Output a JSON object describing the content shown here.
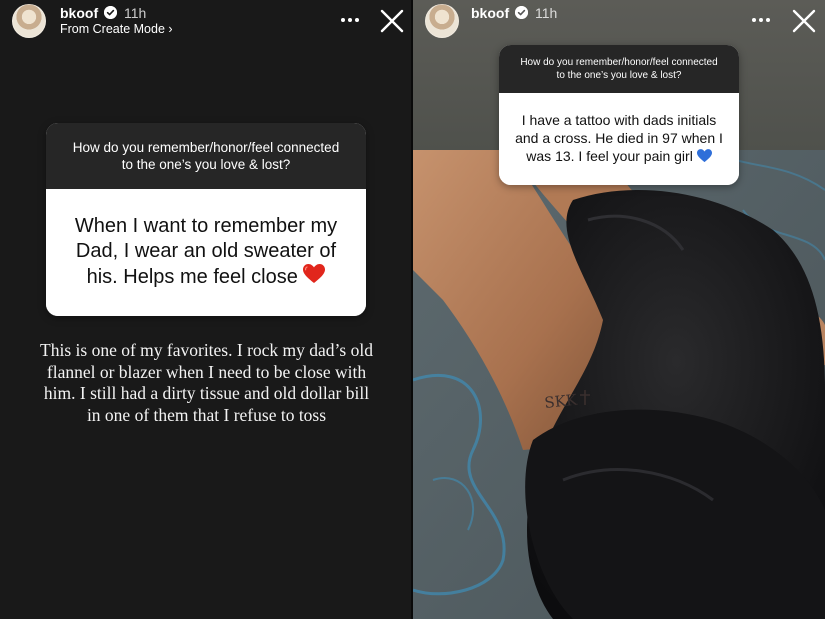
{
  "left_story": {
    "username": "bkoof",
    "time": "11h",
    "subtitle": "From Create Mode ›",
    "question": "How do you remember/honor/feel connected to the one’s you love & lost?",
    "answer": "When I want to remember my Dad, I wear an old sweater of his. Helps me feel close",
    "answer_emoji": "red-heart",
    "caption": "This is one of my favorites. I rock my dad’s old flannel or blazer when I need to be close with him. I still had a dirty tissue and old dollar bill in one of them that I refuse to toss"
  },
  "right_story": {
    "username": "bkoof",
    "time": "11h",
    "question": "How do you remember/honor/feel connected to the one’s you love & lost?",
    "answer": "I have a tattoo with dads initials and a cross. He died in 97 when I was 13. I feel your pain girl",
    "answer_emoji": "blue-heart",
    "tattoo_text": "SKK"
  },
  "icons": {
    "more": "more-horizontal-icon",
    "close": "close-icon",
    "verified": "verified-badge-icon"
  },
  "colors": {
    "left_background": "#191919",
    "question_header": "#262626",
    "answer_background": "#ffffff",
    "red_heart": "#e1261c",
    "blue_heart": "#2f6fd9"
  }
}
